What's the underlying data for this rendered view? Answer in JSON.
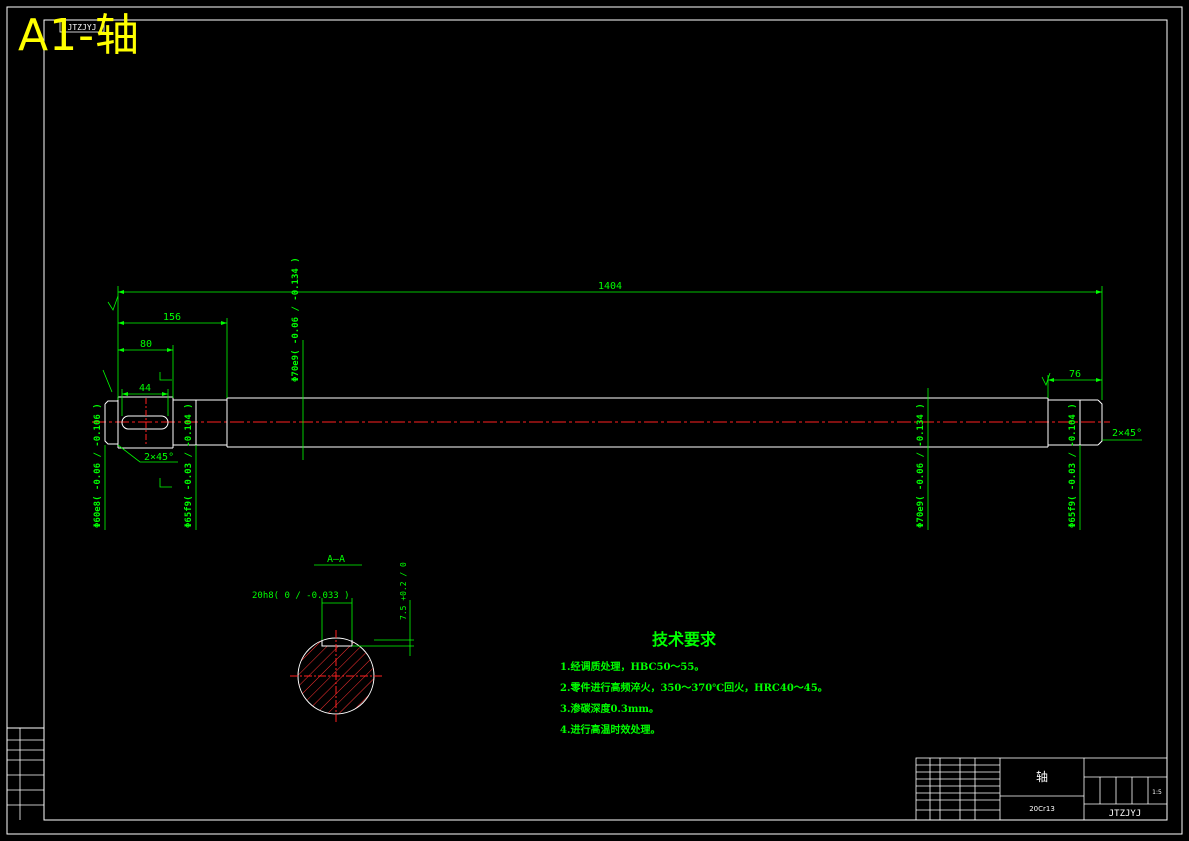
{
  "title_overlay": "A1-轴",
  "top_left_stamp": "JTZJYJ",
  "dimensions": {
    "overall_length": "1404",
    "left_section_length": "156",
    "keyway_offset": "80",
    "keyway_length": "44",
    "right_section_length": "76",
    "left_chamfer": "2×45°",
    "right_chamfer": "2×45°",
    "dia_left_end": "Φ60e8( -0.06 / -0.106 )",
    "dia_bearing_left": "Φ65f9( -0.03 / -0.104 )",
    "dia_mid_top": "Φ70e9( -0.06 / -0.134 )",
    "dia_mid_bottom": "Φ70e9( -0.06 / -0.134 )",
    "dia_right_end": "Φ65f9( -0.03 / -0.104 )",
    "keyway_width": "20h8( 0 / -0.033 )",
    "keyway_depth": "7.5 +0.2 / 0"
  },
  "section_label": "A—A",
  "technical_requirements": {
    "title": "技术要求",
    "items": [
      "1.经调质处理，HBC50～55。",
      "2.零件进行高频淬火，350～370℃回火，HRC40～45。",
      "3.渗碳深度0.3mm。",
      "4.进行高温时效处理。"
    ]
  },
  "title_block": {
    "part_name": "轴",
    "material": "20Cr13",
    "drawing_code": "JTZJYJ",
    "scale": "1:5"
  },
  "colors": {
    "background": "#000000",
    "frame": "#ffffff",
    "dimension": "#00ff00",
    "centerline": "#ff0000",
    "title_overlay": "#ffff00"
  }
}
